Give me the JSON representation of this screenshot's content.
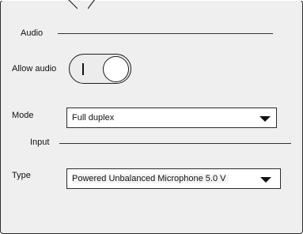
{
  "audio_section": {
    "title": "Audio"
  },
  "allow_audio": {
    "label": "Allow audio",
    "state": "on"
  },
  "mode": {
    "label": "Mode",
    "selected": "Full duplex"
  },
  "input_section": {
    "title": "Input"
  },
  "type": {
    "label": "Type",
    "selected": "Powered Unbalanced Microphone 5.0 V"
  },
  "colors": {
    "panel_bg": "#efefef",
    "border": "#2b2b2b",
    "field_bg": "#ffffff"
  },
  "icons": {
    "dropdown": "chevron-down-icon",
    "toggle_on": "toggle-on-indicator"
  }
}
